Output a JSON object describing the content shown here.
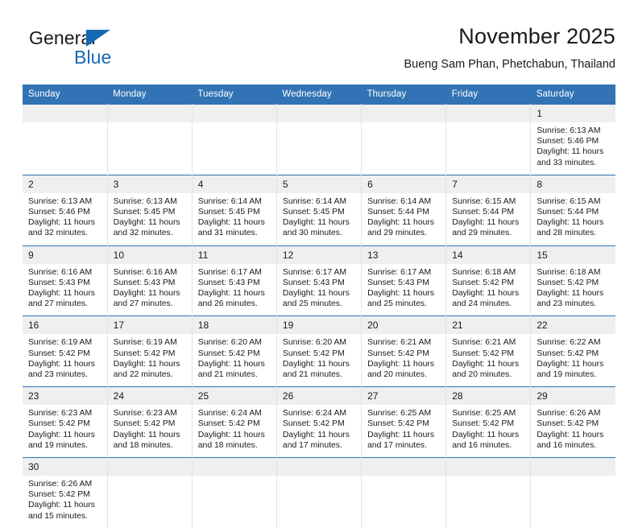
{
  "brand": {
    "name_part1": "General",
    "name_part2": "Blue",
    "flag_color": "#1668b3"
  },
  "header": {
    "title": "November 2025",
    "subtitle": "Bueng Sam Phan, Phetchabun, Thailand",
    "accent_color": "#3173b4",
    "daynum_band_color": "#efefef"
  },
  "weekdays": [
    "Sunday",
    "Monday",
    "Tuesday",
    "Wednesday",
    "Thursday",
    "Friday",
    "Saturday"
  ],
  "weeks": [
    [
      {
        "empty": true
      },
      {
        "empty": true
      },
      {
        "empty": true
      },
      {
        "empty": true
      },
      {
        "empty": true
      },
      {
        "empty": true
      },
      {
        "day": "1",
        "sunrise": "Sunrise: 6:13 AM",
        "sunset": "Sunset: 5:46 PM",
        "daylight1": "Daylight: 11 hours",
        "daylight2": "and 33 minutes."
      }
    ],
    [
      {
        "day": "2",
        "sunrise": "Sunrise: 6:13 AM",
        "sunset": "Sunset: 5:46 PM",
        "daylight1": "Daylight: 11 hours",
        "daylight2": "and 32 minutes."
      },
      {
        "day": "3",
        "sunrise": "Sunrise: 6:13 AM",
        "sunset": "Sunset: 5:45 PM",
        "daylight1": "Daylight: 11 hours",
        "daylight2": "and 32 minutes."
      },
      {
        "day": "4",
        "sunrise": "Sunrise: 6:14 AM",
        "sunset": "Sunset: 5:45 PM",
        "daylight1": "Daylight: 11 hours",
        "daylight2": "and 31 minutes."
      },
      {
        "day": "5",
        "sunrise": "Sunrise: 6:14 AM",
        "sunset": "Sunset: 5:45 PM",
        "daylight1": "Daylight: 11 hours",
        "daylight2": "and 30 minutes."
      },
      {
        "day": "6",
        "sunrise": "Sunrise: 6:14 AM",
        "sunset": "Sunset: 5:44 PM",
        "daylight1": "Daylight: 11 hours",
        "daylight2": "and 29 minutes."
      },
      {
        "day": "7",
        "sunrise": "Sunrise: 6:15 AM",
        "sunset": "Sunset: 5:44 PM",
        "daylight1": "Daylight: 11 hours",
        "daylight2": "and 29 minutes."
      },
      {
        "day": "8",
        "sunrise": "Sunrise: 6:15 AM",
        "sunset": "Sunset: 5:44 PM",
        "daylight1": "Daylight: 11 hours",
        "daylight2": "and 28 minutes."
      }
    ],
    [
      {
        "day": "9",
        "sunrise": "Sunrise: 6:16 AM",
        "sunset": "Sunset: 5:43 PM",
        "daylight1": "Daylight: 11 hours",
        "daylight2": "and 27 minutes."
      },
      {
        "day": "10",
        "sunrise": "Sunrise: 6:16 AM",
        "sunset": "Sunset: 5:43 PM",
        "daylight1": "Daylight: 11 hours",
        "daylight2": "and 27 minutes."
      },
      {
        "day": "11",
        "sunrise": "Sunrise: 6:17 AM",
        "sunset": "Sunset: 5:43 PM",
        "daylight1": "Daylight: 11 hours",
        "daylight2": "and 26 minutes."
      },
      {
        "day": "12",
        "sunrise": "Sunrise: 6:17 AM",
        "sunset": "Sunset: 5:43 PM",
        "daylight1": "Daylight: 11 hours",
        "daylight2": "and 25 minutes."
      },
      {
        "day": "13",
        "sunrise": "Sunrise: 6:17 AM",
        "sunset": "Sunset: 5:43 PM",
        "daylight1": "Daylight: 11 hours",
        "daylight2": "and 25 minutes."
      },
      {
        "day": "14",
        "sunrise": "Sunrise: 6:18 AM",
        "sunset": "Sunset: 5:42 PM",
        "daylight1": "Daylight: 11 hours",
        "daylight2": "and 24 minutes."
      },
      {
        "day": "15",
        "sunrise": "Sunrise: 6:18 AM",
        "sunset": "Sunset: 5:42 PM",
        "daylight1": "Daylight: 11 hours",
        "daylight2": "and 23 minutes."
      }
    ],
    [
      {
        "day": "16",
        "sunrise": "Sunrise: 6:19 AM",
        "sunset": "Sunset: 5:42 PM",
        "daylight1": "Daylight: 11 hours",
        "daylight2": "and 23 minutes."
      },
      {
        "day": "17",
        "sunrise": "Sunrise: 6:19 AM",
        "sunset": "Sunset: 5:42 PM",
        "daylight1": "Daylight: 11 hours",
        "daylight2": "and 22 minutes."
      },
      {
        "day": "18",
        "sunrise": "Sunrise: 6:20 AM",
        "sunset": "Sunset: 5:42 PM",
        "daylight1": "Daylight: 11 hours",
        "daylight2": "and 21 minutes."
      },
      {
        "day": "19",
        "sunrise": "Sunrise: 6:20 AM",
        "sunset": "Sunset: 5:42 PM",
        "daylight1": "Daylight: 11 hours",
        "daylight2": "and 21 minutes."
      },
      {
        "day": "20",
        "sunrise": "Sunrise: 6:21 AM",
        "sunset": "Sunset: 5:42 PM",
        "daylight1": "Daylight: 11 hours",
        "daylight2": "and 20 minutes."
      },
      {
        "day": "21",
        "sunrise": "Sunrise: 6:21 AM",
        "sunset": "Sunset: 5:42 PM",
        "daylight1": "Daylight: 11 hours",
        "daylight2": "and 20 minutes."
      },
      {
        "day": "22",
        "sunrise": "Sunrise: 6:22 AM",
        "sunset": "Sunset: 5:42 PM",
        "daylight1": "Daylight: 11 hours",
        "daylight2": "and 19 minutes."
      }
    ],
    [
      {
        "day": "23",
        "sunrise": "Sunrise: 6:23 AM",
        "sunset": "Sunset: 5:42 PM",
        "daylight1": "Daylight: 11 hours",
        "daylight2": "and 19 minutes."
      },
      {
        "day": "24",
        "sunrise": "Sunrise: 6:23 AM",
        "sunset": "Sunset: 5:42 PM",
        "daylight1": "Daylight: 11 hours",
        "daylight2": "and 18 minutes."
      },
      {
        "day": "25",
        "sunrise": "Sunrise: 6:24 AM",
        "sunset": "Sunset: 5:42 PM",
        "daylight1": "Daylight: 11 hours",
        "daylight2": "and 18 minutes."
      },
      {
        "day": "26",
        "sunrise": "Sunrise: 6:24 AM",
        "sunset": "Sunset: 5:42 PM",
        "daylight1": "Daylight: 11 hours",
        "daylight2": "and 17 minutes."
      },
      {
        "day": "27",
        "sunrise": "Sunrise: 6:25 AM",
        "sunset": "Sunset: 5:42 PM",
        "daylight1": "Daylight: 11 hours",
        "daylight2": "and 17 minutes."
      },
      {
        "day": "28",
        "sunrise": "Sunrise: 6:25 AM",
        "sunset": "Sunset: 5:42 PM",
        "daylight1": "Daylight: 11 hours",
        "daylight2": "and 16 minutes."
      },
      {
        "day": "29",
        "sunrise": "Sunrise: 6:26 AM",
        "sunset": "Sunset: 5:42 PM",
        "daylight1": "Daylight: 11 hours",
        "daylight2": "and 16 minutes."
      }
    ],
    [
      {
        "day": "30",
        "sunrise": "Sunrise: 6:26 AM",
        "sunset": "Sunset: 5:42 PM",
        "daylight1": "Daylight: 11 hours",
        "daylight2": "and 15 minutes."
      },
      {
        "empty": true
      },
      {
        "empty": true
      },
      {
        "empty": true
      },
      {
        "empty": true
      },
      {
        "empty": true
      },
      {
        "empty": true
      }
    ]
  ]
}
